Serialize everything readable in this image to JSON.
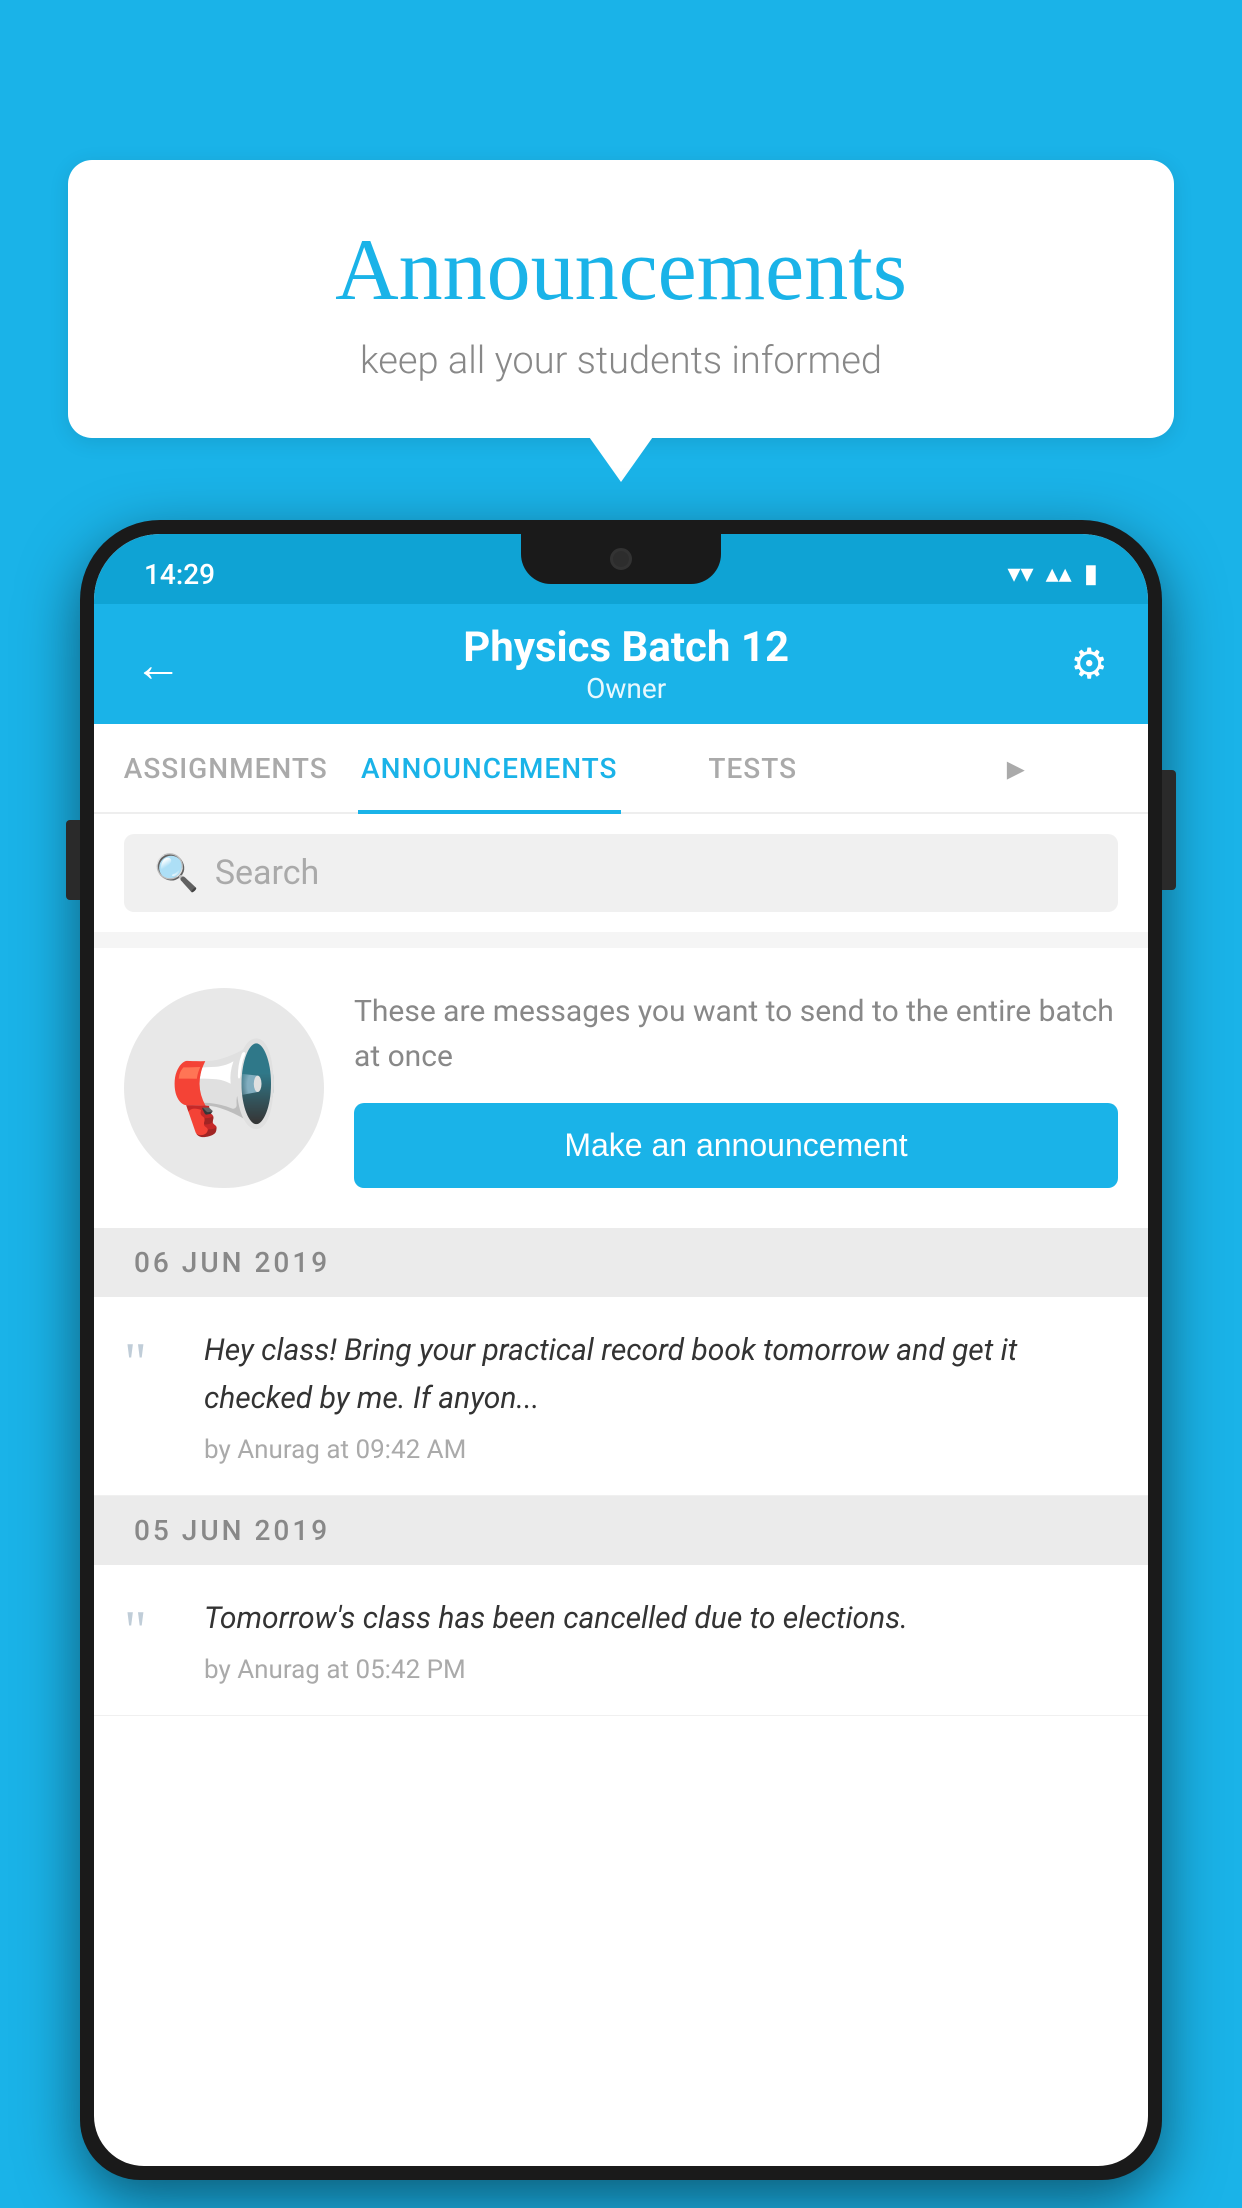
{
  "background_color": "#1ab3e8",
  "speech_bubble": {
    "title": "Announcements",
    "subtitle": "keep all your students informed"
  },
  "status_bar": {
    "time": "14:29",
    "wifi": "▾",
    "signal": "▴",
    "battery": "▮"
  },
  "app_bar": {
    "back_label": "←",
    "title": "Physics Batch 12",
    "subtitle": "Owner",
    "settings_label": "⚙"
  },
  "tabs": [
    {
      "label": "ASSIGNMENTS",
      "active": false
    },
    {
      "label": "ANNOUNCEMENTS",
      "active": true
    },
    {
      "label": "TESTS",
      "active": false
    },
    {
      "label": "•••",
      "active": false
    }
  ],
  "search": {
    "placeholder": "Search"
  },
  "announcement_prompt": {
    "description_text": "These are messages you want to send to the entire batch at once",
    "button_label": "Make an announcement"
  },
  "date_groups": [
    {
      "date": "06  JUN  2019",
      "announcements": [
        {
          "text": "Hey class! Bring your practical record book tomorrow and get it checked by me. If anyon...",
          "meta": "by Anurag at 09:42 AM"
        }
      ]
    },
    {
      "date": "05  JUN  2019",
      "announcements": [
        {
          "text": "Tomorrow's class has been cancelled due to elections.",
          "meta": "by Anurag at 05:42 PM"
        }
      ]
    }
  ],
  "icons": {
    "megaphone": "📢",
    "quote": "“",
    "search": "🔍"
  }
}
